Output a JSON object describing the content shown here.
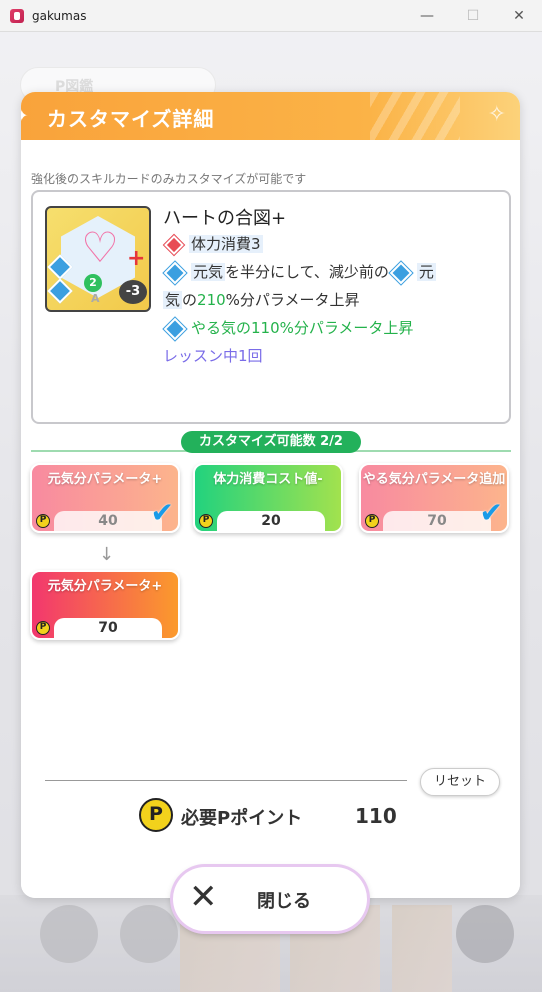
{
  "window": {
    "title": "gakumas",
    "minimize": "—",
    "maximize": "☐",
    "close": "✕"
  },
  "background": {
    "tab_label": "P図鑑"
  },
  "dialog": {
    "title": "カスタマイズ詳細",
    "note": "強化後のスキルカードのみカスタマイズが可能です",
    "card": {
      "name": "ハートの合図+",
      "cost_badge": "2",
      "minus_badge": "-3",
      "rarity": "A",
      "effects": {
        "line1": "体力消費3",
        "line2a": "元気",
        "line2b": "を半分にして、減少前の",
        "line2c": "元",
        "line3a": "気",
        "line3b": "の",
        "line3c": "210",
        "line3d": "%分パラメータ上昇",
        "line4": "やる気の110%分パラメータ上昇",
        "line5": "レッスン中1回"
      }
    },
    "customize_count": "カスタマイズ可能数 2/2",
    "options": [
      {
        "label": "元気分パラメータ+",
        "cost": "40",
        "selected": true
      },
      {
        "label": "体力消費コスト値-",
        "cost": "20",
        "selected": false
      },
      {
        "label": "やる気分パラメータ追加",
        "cost": "70",
        "selected": true
      },
      {
        "label": "元気分パラメータ+",
        "cost": "70",
        "selected": false
      }
    ],
    "p_symbol": "P",
    "reset_label": "リセット",
    "required_label": "必要Pポイント",
    "required_value": "110",
    "close_label": "閉じる",
    "close_icon": "✕"
  }
}
